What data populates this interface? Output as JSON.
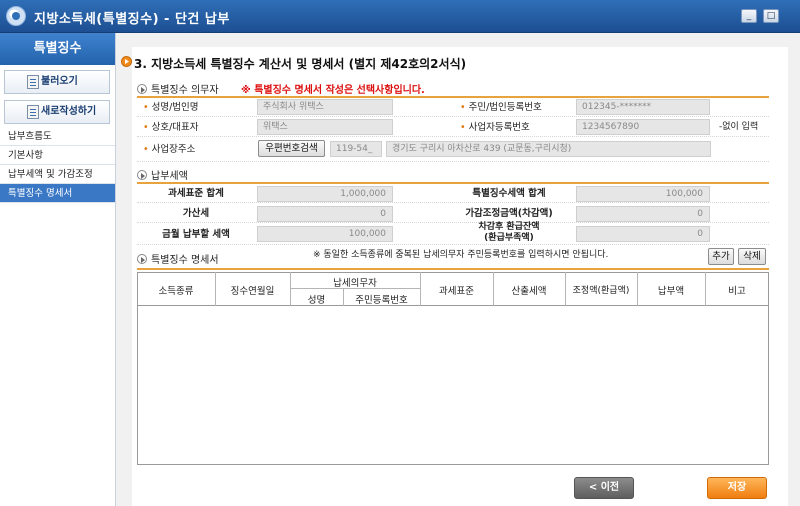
{
  "window": {
    "title": "지방소득세(특별징수) - 단건 납부",
    "min_label": "_",
    "max_label": "□"
  },
  "sidebar": {
    "header": "특별징수",
    "load_button": "불러오기",
    "new_button": "새로작성하기",
    "items": [
      {
        "label": "납부흐름도"
      },
      {
        "label": "기본사항"
      },
      {
        "label": "납부세액 및 가감조정"
      },
      {
        "label": "특별징수 명세서"
      }
    ]
  },
  "main": {
    "section_title": "3. 지방소득세 특별징수 계산서 및 명세서 (별지 제42호의2서식)",
    "obligor": {
      "title": "특별징수 의무자",
      "note": "※ 특별징수 명세서 작성은 선택사항입니다.",
      "name_label": "성명/법인명",
      "name_value": "주식회사 위택스",
      "regno_label": "주민/법인등록번호",
      "regno_value": "012345-*******",
      "trade_label": "상호/대표자",
      "trade_value": "위택스",
      "bizno_label": "사업자등록번호",
      "bizno_value": "1234567890",
      "bizno_note": "-없이 입력",
      "addr_label": "사업장주소",
      "zip_button": "우편번호검색",
      "zip_value": "119-54_",
      "addr_value": "경기도 구리시 아차산로 439 (교문동,구리시청)"
    },
    "tax": {
      "title": "납부세액",
      "base_total_label": "과세표준 합계",
      "base_total_value": "1,000,000",
      "special_total_label": "특별징수세액 합계",
      "special_total_value": "100,000",
      "surtax_label": "가산세",
      "surtax_value": "0",
      "adjust_label": "가감조정금액(차감액)",
      "adjust_value": "0",
      "pay_label": "금월 납부할 세액",
      "pay_value": "100,000",
      "refund_label_1": "차감후 환급잔액",
      "refund_label_2": "(환급부족액)",
      "refund_value": "0"
    },
    "statement": {
      "title": "특별징수 명세서",
      "note": "※ 동일한 소득종류에 중복된 납세의무자 주민등록번호를 입력하시면 안됩니다.",
      "add_button": "추가",
      "delete_button": "삭제",
      "columns": {
        "income_type": "소득종류",
        "period": "징수연월일",
        "taxpayer": "납세의무자",
        "name": "성명",
        "regno": "주민등록번호",
        "tax_base": "과세표준",
        "calc_tax": "산출세액",
        "adjust": "조정액(환급액)",
        "paid": "납부액",
        "remark": "비고"
      }
    }
  },
  "footer": {
    "prev_button": "< 이전",
    "save_button": "저장"
  }
}
